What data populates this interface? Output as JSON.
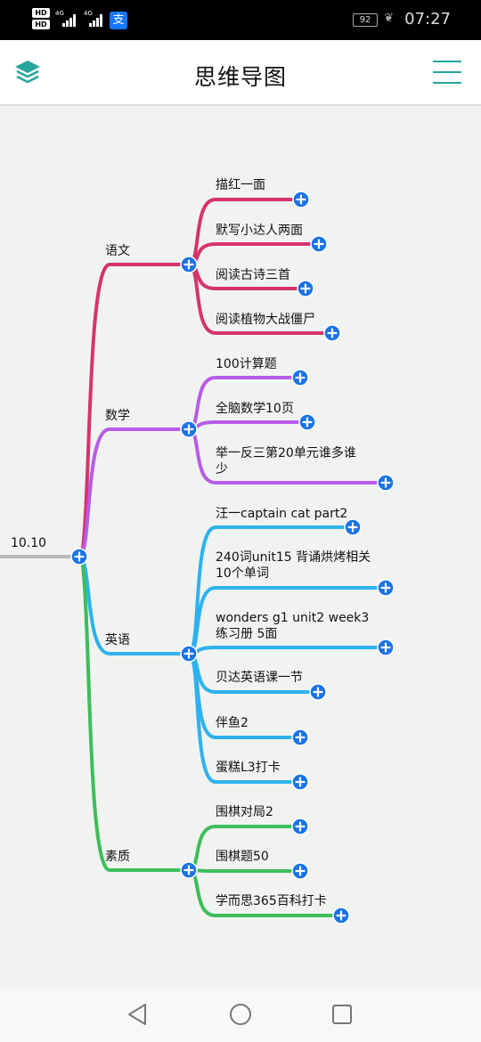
{
  "status_bar": {
    "hd_badges": [
      "HD",
      "HD"
    ],
    "network_1": "4G",
    "network_2": "4G",
    "app_icon": "支",
    "battery": "92",
    "time": "07:27"
  },
  "header": {
    "title": "思维导图",
    "left_icon": "layers-icon",
    "right_icon": "menu-icon"
  },
  "mindmap": {
    "root": "10.10",
    "colors": {
      "root_line": "#b9b9b9",
      "chinese": "#d6336c",
      "math": "#b65ce6",
      "english": "#2eb2ee",
      "quality": "#3dbd5b",
      "plus_button": "#1a73e8"
    },
    "branches": [
      {
        "label": "语文",
        "items": [
          "描红一面",
          "默写小达人两面",
          "阅读古诗三首",
          "阅读植物大战僵尸"
        ]
      },
      {
        "label": "数学",
        "items": [
          "100计算题",
          "全脑数学10页",
          "举一反三第20单元谁多谁\n少"
        ]
      },
      {
        "label": "英语",
        "items": [
          "汪一captain cat part2",
          "240词unit15 背诵烘烤相关\n10个单词",
          "wonders g1 unit2 week3\n练习册 5面",
          "贝达英语课一节",
          "伴鱼2",
          "蛋糕L3打卡"
        ]
      },
      {
        "label": "素质",
        "items": [
          "围棋对局2",
          "围棋题50",
          "学而思365百科打卡"
        ]
      }
    ]
  },
  "nav": {
    "back_icon": "back-triangle-icon",
    "home_icon": "home-circle-icon",
    "recents_icon": "recents-square-icon"
  }
}
